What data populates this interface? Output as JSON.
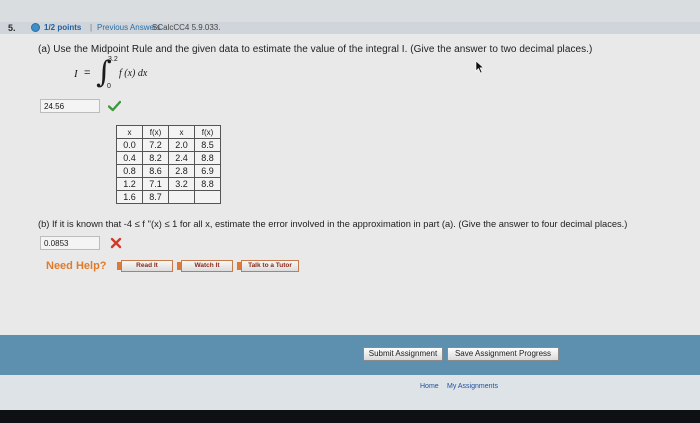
{
  "header": {
    "question_number": "5.",
    "points": "1/2 points",
    "separator": "|",
    "previous_answers": "Previous Answers",
    "course_code": "SCalcCC4 5.9.033."
  },
  "part_a": {
    "prompt": "(a) Use the Midpoint Rule and the given data to estimate the value of the integral I. (Give the answer to two decimal places.)",
    "integral": {
      "lhs": "I",
      "eq": "=",
      "sign": "∫",
      "upper": "3.2",
      "lower": "0",
      "integrand": "f (x) dx"
    },
    "answer": "24.56",
    "status_icon": "check-icon"
  },
  "table": {
    "headers": [
      "x",
      "f(x)",
      "x",
      "f(x)"
    ],
    "rows": [
      [
        "0.0",
        "7.2",
        "2.0",
        "8.5"
      ],
      [
        "0.4",
        "8.2",
        "2.4",
        "8.8"
      ],
      [
        "0.8",
        "8.6",
        "2.8",
        "6.9"
      ],
      [
        "1.2",
        "7.1",
        "3.2",
        "8.8"
      ],
      [
        "1.6",
        "8.7",
        "",
        ""
      ]
    ]
  },
  "part_b": {
    "prompt": "(b) If it is known that -4 ≤ f ''(x) ≤ 1 for all x, estimate the error involved in the approximation in part (a). (Give the answer to four decimal places.)",
    "answer": "0.0853",
    "status_icon": "x-icon"
  },
  "help": {
    "label": "Need Help?",
    "read": "Read It",
    "watch": "Watch It",
    "tutor": "Talk to a Tutor"
  },
  "footer": {
    "submit": "Submit Assignment",
    "save": "Save Assignment Progress",
    "home": "Home",
    "my_assignments": "My Assignments"
  },
  "colors": {
    "accent_blue": "#5d8fae",
    "correct_green": "#3c9a3c",
    "wrong_red": "#d23b2a",
    "help_orange": "#e07b2c"
  }
}
